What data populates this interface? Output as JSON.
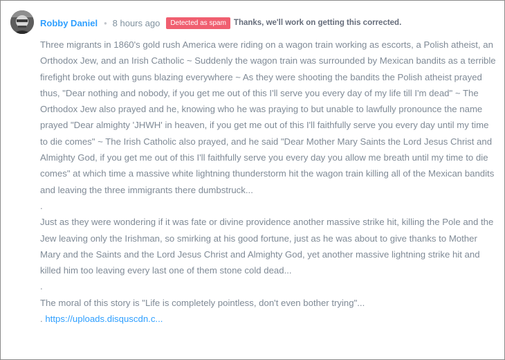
{
  "comment": {
    "author": "Robby Daniel",
    "separator": "•",
    "timestamp": "8 hours ago",
    "spam_badge": "Detected as spam",
    "spam_note": "Thanks, we'll work on getting this corrected.",
    "paragraph_1": "Three migrants in 1860's gold rush America were riding on a wagon train working as escorts, a Polish atheist, an Orthodox Jew, and an Irish Catholic ~ Suddenly the wagon train was surrounded by Mexican bandits as a terrible firefight broke out with guns blazing everywhere ~ As they were shooting the bandits the Polish atheist prayed thus, \"Dear nothing and nobody, if you get me out of this I'll serve you every day of my life till I'm dead\" ~ The Orthodox Jew also prayed and he, knowing who he was praying to but unable to lawfully pronounce the name prayed \"Dear almighty 'JHWH' in heaven, if you get me out of this I'll faithfully serve you every day until my time to die comes\" ~ The Irish Catholic also prayed, and he said \"Dear Mother Mary Saints the Lord Jesus Christ and Almighty God, if you get me out of this I'll faithfully serve you every day you allow me breath until my time to die comes\" at which time a massive white lightning thunderstorm hit the wagon train killing all of the Mexican bandits and leaving the three immigrants there dumbstruck...",
    "dot_1": ".",
    "paragraph_2": "Just as they were wondering if it was fate or divine providence another massive strike hit, killing the Pole and the Jew leaving only the Irishman, so smirking at his good fortune, just as he was about to give thanks to Mother Mary and the Saints and the Lord Jesus Christ and Almighty God, yet another massive lightning strike hit and killed him too leaving every last one of them stone cold dead...",
    "dot_2": ".",
    "paragraph_3": "The moral of this story is \"Life is completely pointless, don't even bother trying\"...",
    "link_prefix": ". ",
    "link_text": "https://uploads.disquscdn.c..."
  },
  "colors": {
    "author": "#2e9fff",
    "body_text": "#7f8a96",
    "spam_badge_bg": "#f05f70",
    "link": "#2e9fff"
  },
  "icons": {
    "avatar": "user-avatar"
  }
}
